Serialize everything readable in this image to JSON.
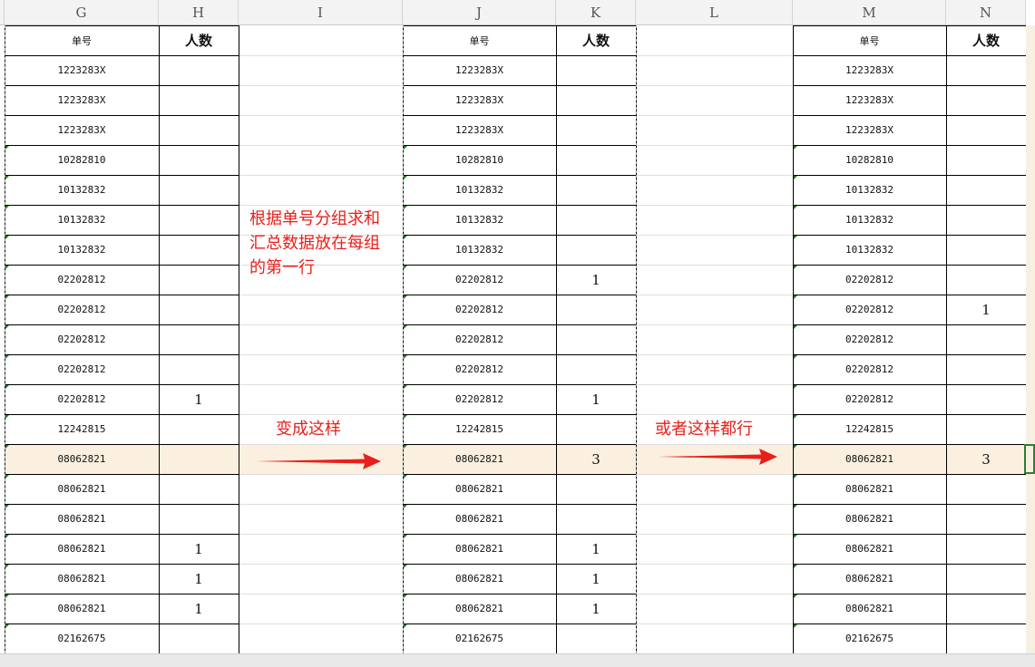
{
  "columns": [
    "G",
    "H",
    "I",
    "J",
    "K",
    "L",
    "M",
    "N"
  ],
  "headers": {
    "danhao": "单号",
    "renshu": "人数"
  },
  "rows": [
    {
      "id": "1223283X",
      "h": "",
      "k": "",
      "n": ""
    },
    {
      "id": "1223283X",
      "h": "",
      "k": "",
      "n": ""
    },
    {
      "id": "1223283X",
      "h": "",
      "k": "",
      "n": ""
    },
    {
      "id": "10282810",
      "h": "",
      "k": "",
      "n": ""
    },
    {
      "id": "10132832",
      "h": "",
      "k": "",
      "n": ""
    },
    {
      "id": "10132832",
      "h": "",
      "k": "",
      "n": ""
    },
    {
      "id": "10132832",
      "h": "",
      "k": "",
      "n": ""
    },
    {
      "id": "02202812",
      "h": "",
      "k": "1",
      "n": ""
    },
    {
      "id": "02202812",
      "h": "",
      "k": "",
      "n": "1"
    },
    {
      "id": "02202812",
      "h": "",
      "k": "",
      "n": ""
    },
    {
      "id": "02202812",
      "h": "",
      "k": "",
      "n": ""
    },
    {
      "id": "02202812",
      "h": "1",
      "k": "1",
      "n": ""
    },
    {
      "id": "12242815",
      "h": "",
      "k": "",
      "n": ""
    },
    {
      "id": "08062821",
      "h": "",
      "k": "3",
      "n": "3"
    },
    {
      "id": "08062821",
      "h": "",
      "k": "",
      "n": ""
    },
    {
      "id": "08062821",
      "h": "",
      "k": "",
      "n": ""
    },
    {
      "id": "08062821",
      "h": "1",
      "k": "1",
      "n": ""
    },
    {
      "id": "08062821",
      "h": "1",
      "k": "1",
      "n": ""
    },
    {
      "id": "08062821",
      "h": "1",
      "k": "1",
      "n": ""
    },
    {
      "id": "02162675",
      "h": "",
      "k": "",
      "n": ""
    }
  ],
  "notes": {
    "instruction": [
      "根据单号分组求和",
      "汇总数据放在每组",
      "的第一行"
    ],
    "become": "变成这样",
    "or_like_this": "或者这样都行"
  },
  "colors": {
    "note": "#e8201b",
    "arrow": "#e8201b",
    "highlight": "#fbf0df",
    "selection": "#2e7d32",
    "green_marker": "#1f7a1f"
  }
}
